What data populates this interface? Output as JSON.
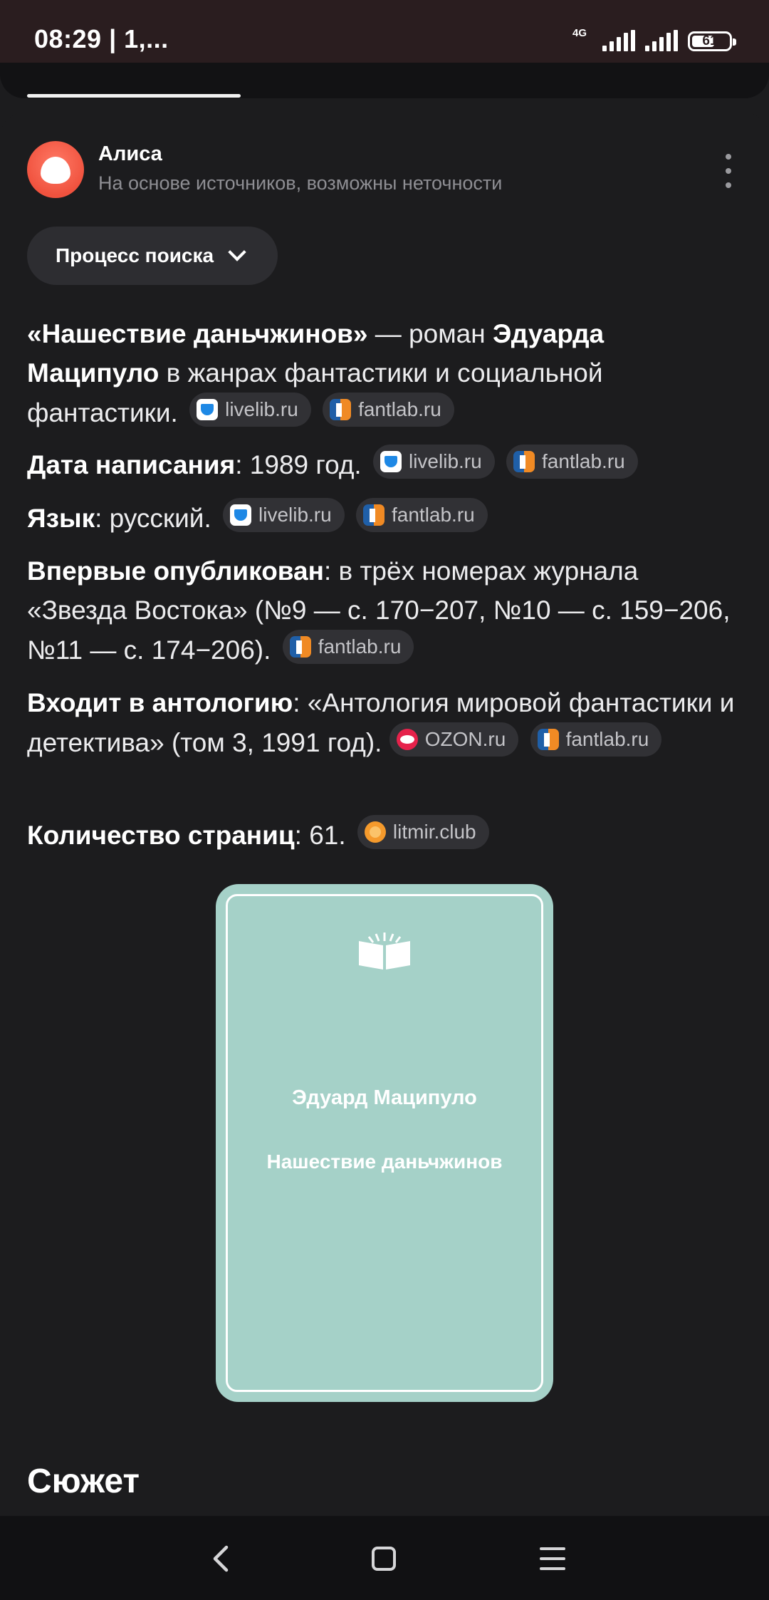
{
  "status_bar": {
    "time": "08:29 | 1,...",
    "network": "4G",
    "battery": "61",
    "battery_level": 0.61
  },
  "alisa": {
    "name": "Алиса",
    "subtitle": "На основе источников, возможны неточности",
    "search_process_label": "Процесс поиска"
  },
  "facts": {
    "f1": {
      "title": "«Нашествие даньчжинов»",
      "t2": " — роман ",
      "author": "Эдуарда Маципуло",
      "t4": " в жанрах фантастики и социальной фантастики.",
      "src1": "livelib.ru",
      "src2": "fantlab.ru"
    },
    "f2": {
      "label": "Дата написания",
      "value": ": 1989 год.",
      "src1": "livelib.ru",
      "src2": "fantlab.ru"
    },
    "f3": {
      "label": "Язык",
      "value": ": русский.",
      "src1": "livelib.ru",
      "src2": "fantlab.ru"
    },
    "f4": {
      "label": "Впервые опубликован",
      "value": ": в трёх номерах журнала «Звезда Востока» (№9 — с. 170−207, №10 — с. 159−206, №11 — с. 174−206).",
      "src1": "fantlab.ru"
    },
    "f5": {
      "label": "Входит в антологию",
      "value": ": «Антология мировой фантастики и детектива» (том 3, 1991 год).",
      "src1": "OZON.ru",
      "src2": "fantlab.ru"
    },
    "f6": {
      "label": "Количество страниц",
      "value": ": 61.",
      "src1": "litmir.club"
    }
  },
  "cover": {
    "author": "Эдуард Маципуло",
    "title": "Нашествие даньчжинов"
  },
  "section": {
    "title": "Сюжет"
  },
  "icons": {
    "logo": "alisa-logo-icon",
    "more": "more-vertical-icon",
    "chevron": "chevron-down-icon",
    "back": "back-icon",
    "home": "home-icon",
    "menu": "menu-icon"
  },
  "colors": {
    "background": "#1c1c1e",
    "status_bar": "#2a1d1f",
    "chip": "#313135",
    "alisa_accent": "#f0523e",
    "cover": "#a5d1c8"
  }
}
